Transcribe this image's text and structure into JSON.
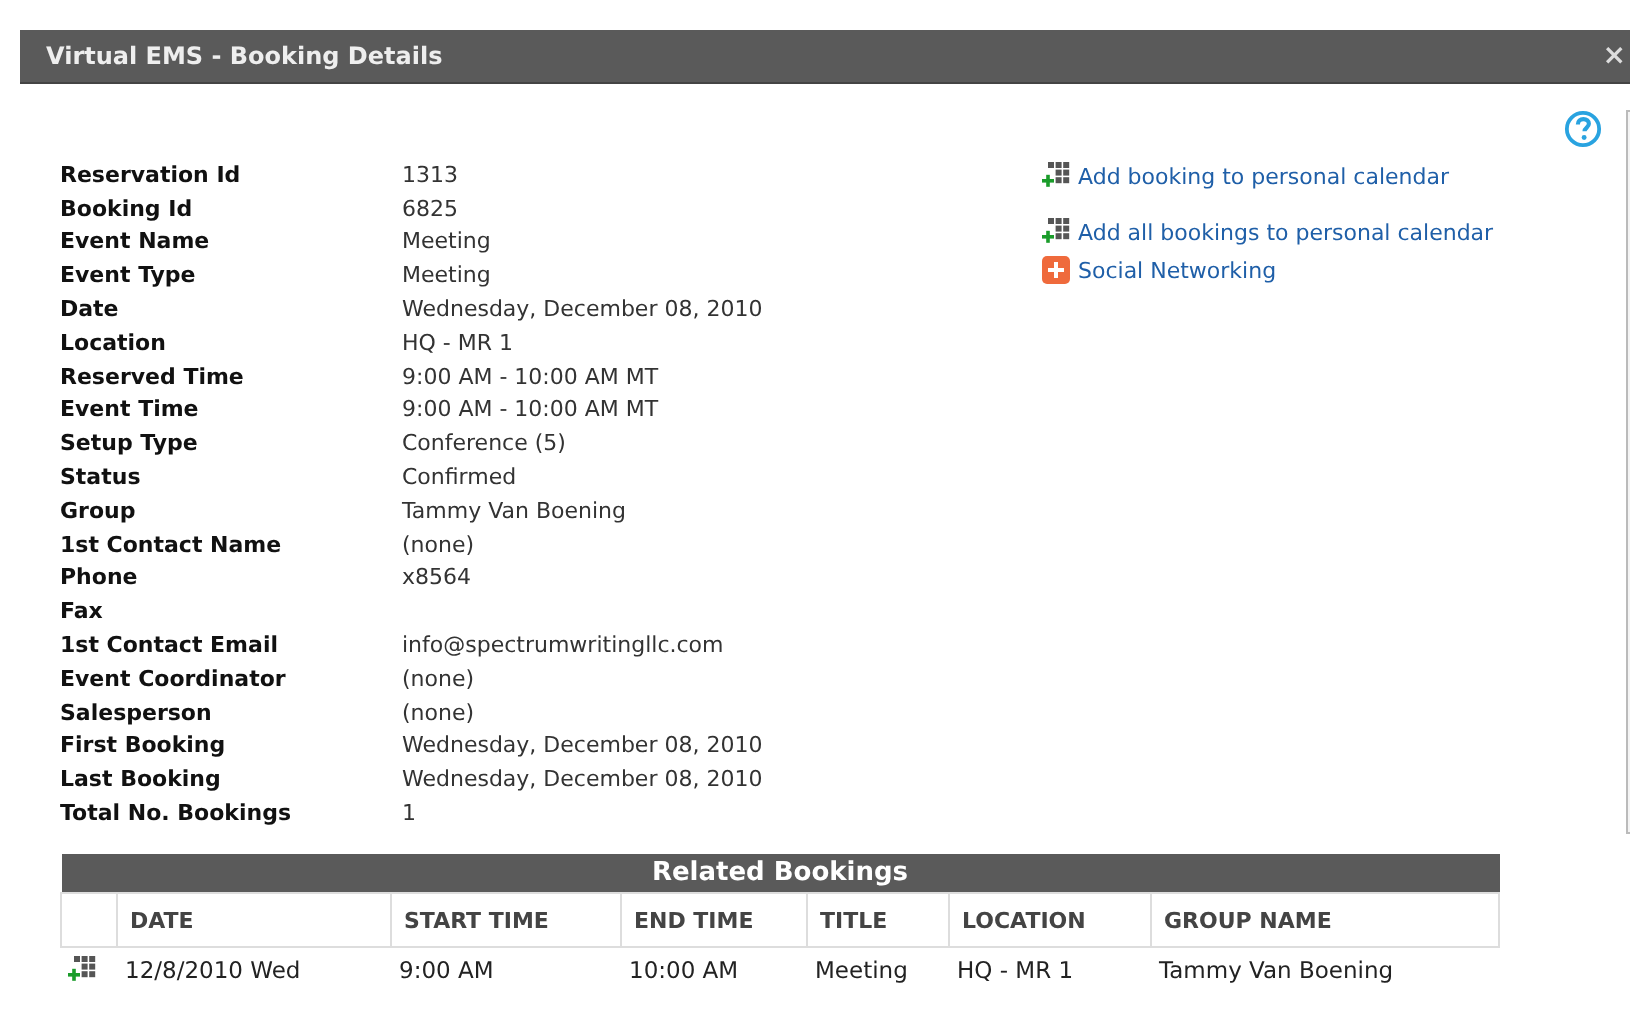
{
  "window": {
    "title": "Virtual EMS - Booking Details",
    "close": "×"
  },
  "details": [
    {
      "label": "Reservation Id",
      "value": "1313"
    },
    {
      "label": "Booking Id",
      "value": "6825"
    },
    {
      "label": "Event Name",
      "value": "Meeting"
    },
    {
      "label": "Event Type",
      "value": "Meeting"
    },
    {
      "label": "Date",
      "value": "Wednesday, December 08, 2010"
    },
    {
      "label": "Location",
      "value": "HQ - MR 1"
    },
    {
      "label": "Reserved Time",
      "value": "9:00 AM - 10:00 AM MT"
    },
    {
      "label": "Event Time",
      "value": "9:00 AM - 10:00 AM MT"
    },
    {
      "label": "Setup Type",
      "value": "Conference (5)"
    },
    {
      "label": "Status",
      "value": "Confirmed"
    },
    {
      "label": "Group",
      "value": "Tammy Van Boening"
    },
    {
      "label": "1st Contact Name",
      "value": "(none)"
    },
    {
      "label": "Phone",
      "value": "x8564"
    },
    {
      "label": "Fax"
    },
    {
      "label": "1st Contact Email",
      "value": "info@spectrumwritingllc.com"
    },
    {
      "label": "Event Coordinator",
      "value": "(none)"
    },
    {
      "label": "Salesperson",
      "value": "(none)"
    },
    {
      "label": "First Booking",
      "value": "Wednesday, December 08, 2010"
    },
    {
      "label": "Last Booking",
      "value": "Wednesday, December 08, 2010"
    },
    {
      "label": "Total No. Bookings",
      "value": "1"
    }
  ],
  "links": [
    {
      "kind": "calendar",
      "label": "Add booking to personal calendar"
    },
    {
      "kind": "calendar",
      "label": "Add all bookings to personal calendar"
    },
    {
      "kind": "social",
      "label": "Social Networking"
    }
  ],
  "related_bookings": {
    "title": "Related Bookings",
    "columns": [
      "DATE",
      "START TIME",
      "END TIME",
      "TITLE",
      "LOCATION",
      "GROUP NAME"
    ],
    "rows": [
      {
        "cells": [
          "12/8/2010 Wed",
          "9:00 AM",
          "10:00 AM",
          "Meeting",
          "HQ - MR 1",
          "Tammy Van Boening"
        ]
      }
    ]
  }
}
